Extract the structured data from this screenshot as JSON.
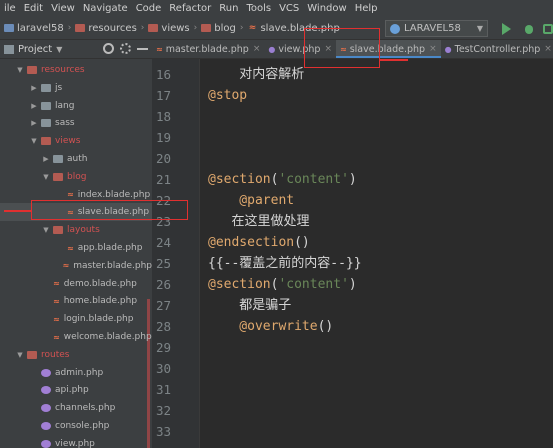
{
  "menubar": {
    "items": [
      {
        "label": "ile",
        "mnemonic": ""
      },
      {
        "label": "Edit",
        "mnemonic": "E"
      },
      {
        "label": "View",
        "mnemonic": "V"
      },
      {
        "label": "Navigate",
        "mnemonic": "N"
      },
      {
        "label": "Code",
        "mnemonic": "C"
      },
      {
        "label": "Refactor",
        "mnemonic": "R"
      },
      {
        "label": "Run",
        "mnemonic": "u"
      },
      {
        "label": "Tools",
        "mnemonic": "T"
      },
      {
        "label": "VCS",
        "mnemonic": "S"
      },
      {
        "label": "Window",
        "mnemonic": "W"
      },
      {
        "label": "Help",
        "mnemonic": "H"
      }
    ]
  },
  "breadcrumb": {
    "items": [
      "laravel58",
      "resources",
      "views",
      "blog",
      "slave.blade.php"
    ]
  },
  "toolbar": {
    "run_config": "LARAVEL58"
  },
  "project_panel": {
    "label": "Project"
  },
  "tabs": [
    {
      "label": "master.blade.php",
      "type": "blade",
      "active": false
    },
    {
      "label": "view.php",
      "type": "php",
      "active": false
    },
    {
      "label": "slave.blade.php",
      "type": "blade",
      "active": true
    },
    {
      "label": "TestController.php",
      "type": "php",
      "active": false
    }
  ],
  "tree": [
    {
      "label": "resources",
      "depth": 1,
      "kind": "folder",
      "open": true,
      "red": true
    },
    {
      "label": "js",
      "depth": 2,
      "kind": "folder",
      "open": false,
      "red": false
    },
    {
      "label": "lang",
      "depth": 2,
      "kind": "folder",
      "open": false,
      "red": false
    },
    {
      "label": "sass",
      "depth": 2,
      "kind": "folder",
      "open": false,
      "red": false
    },
    {
      "label": "views",
      "depth": 2,
      "kind": "folder",
      "open": true,
      "red": true
    },
    {
      "label": "auth",
      "depth": 3,
      "kind": "folder",
      "open": false,
      "red": false
    },
    {
      "label": "blog",
      "depth": 3,
      "kind": "folder",
      "open": true,
      "red": true
    },
    {
      "label": "index.blade.php",
      "depth": 4,
      "kind": "blade",
      "open": false,
      "red": false
    },
    {
      "label": "slave.blade.php",
      "depth": 4,
      "kind": "blade",
      "open": false,
      "red": false,
      "selected": true
    },
    {
      "label": "layouts",
      "depth": 3,
      "kind": "folder",
      "open": true,
      "red": true
    },
    {
      "label": "app.blade.php",
      "depth": 4,
      "kind": "blade",
      "open": false,
      "red": false
    },
    {
      "label": "master.blade.php",
      "depth": 4,
      "kind": "blade",
      "open": false,
      "red": false
    },
    {
      "label": "demo.blade.php",
      "depth": 3,
      "kind": "blade",
      "open": false,
      "red": false
    },
    {
      "label": "home.blade.php",
      "depth": 3,
      "kind": "blade",
      "open": false,
      "red": false
    },
    {
      "label": "login.blade.php",
      "depth": 3,
      "kind": "blade",
      "open": false,
      "red": false
    },
    {
      "label": "welcome.blade.php",
      "depth": 3,
      "kind": "blade",
      "open": false,
      "red": false
    },
    {
      "label": "routes",
      "depth": 1,
      "kind": "folder",
      "open": true,
      "red": true
    },
    {
      "label": "admin.php",
      "depth": 2,
      "kind": "php",
      "open": false,
      "red": false
    },
    {
      "label": "api.php",
      "depth": 2,
      "kind": "php",
      "open": false,
      "red": false
    },
    {
      "label": "channels.php",
      "depth": 2,
      "kind": "php",
      "open": false,
      "red": false
    },
    {
      "label": "console.php",
      "depth": 2,
      "kind": "php",
      "open": false,
      "red": false
    },
    {
      "label": "view.php",
      "depth": 2,
      "kind": "php",
      "open": false,
      "red": false
    }
  ],
  "editor": {
    "line_numbers": [
      "16",
      "17",
      "18",
      "19",
      "20",
      "21",
      "22",
      "23",
      "24",
      "25",
      "26",
      "27",
      "28",
      "29",
      "30",
      "31",
      "32",
      "33"
    ],
    "lines": [
      [
        {
          "t": "    对内容解析",
          "c": "plain"
        }
      ],
      [
        {
          "t": "@stop",
          "c": "dir"
        }
      ],
      [],
      [],
      [],
      [
        {
          "t": "@section",
          "c": "dir"
        },
        {
          "t": "(",
          "c": "plain"
        },
        {
          "t": "'content'",
          "c": "str"
        },
        {
          "t": ")",
          "c": "plain"
        }
      ],
      [
        {
          "t": "    @parent",
          "c": "dir"
        }
      ],
      [
        {
          "t": "   在这里做处理",
          "c": "plain"
        }
      ],
      [
        {
          "t": "@endsection",
          "c": "dir"
        },
        {
          "t": "()",
          "c": "plain"
        }
      ],
      [
        {
          "t": "{{--覆盖之前的内容--}}",
          "c": "cmt"
        }
      ],
      [
        {
          "t": "@section",
          "c": "dir"
        },
        {
          "t": "(",
          "c": "plain"
        },
        {
          "t": "'content'",
          "c": "str"
        },
        {
          "t": ")",
          "c": "plain"
        }
      ],
      [
        {
          "t": "    都是骗子",
          "c": "plain"
        }
      ],
      [
        {
          "t": "    @overwrite",
          "c": "dir"
        },
        {
          "t": "()",
          "c": "plain"
        }
      ],
      [],
      [],
      [],
      [],
      []
    ]
  },
  "colors": {
    "accent_tab_underline": "#4a88c7",
    "annotation_red": "#e03030",
    "blade_directive": "#e0a96e",
    "string_green": "#6a8759"
  }
}
